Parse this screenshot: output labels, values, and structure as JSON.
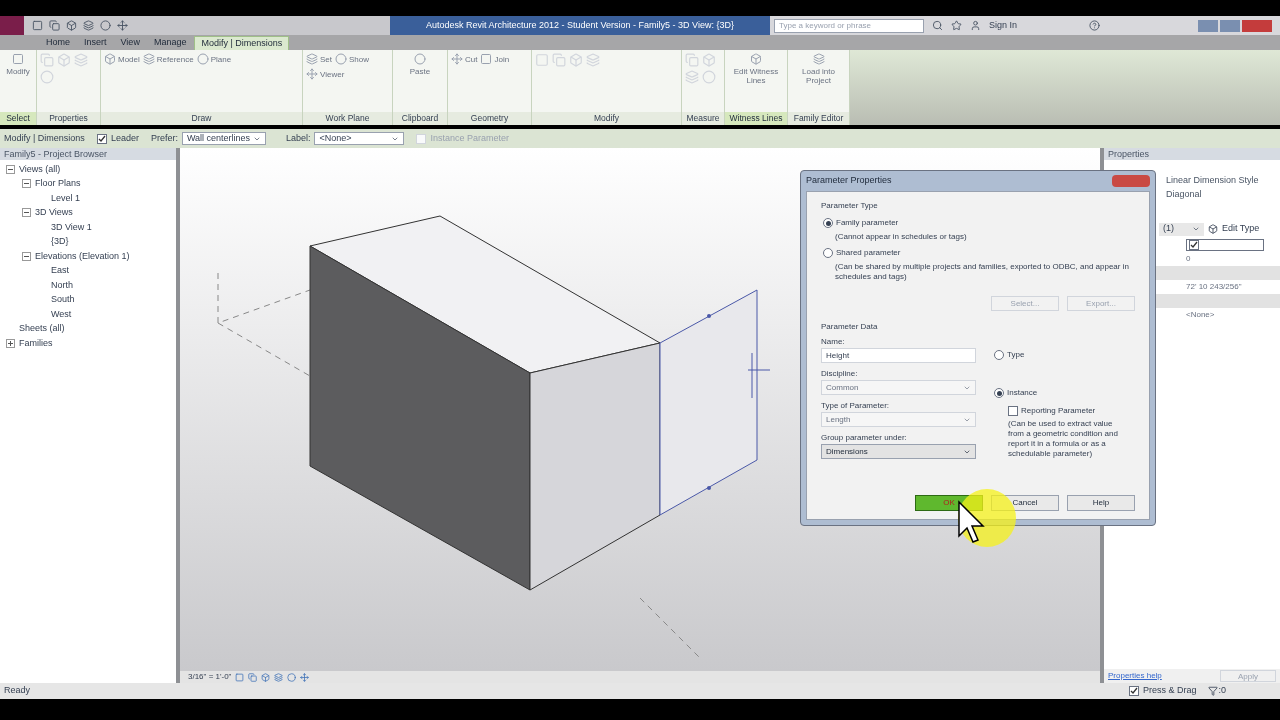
{
  "title_bar": {
    "title": "Autodesk Revit Architecture 2012 - Student Version - Family5 - 3D View: {3D}",
    "search_placeholder": "Type a keyword or phrase",
    "sign_in": "Sign In"
  },
  "tabs": [
    {
      "label": "Home",
      "selected": false
    },
    {
      "label": "Insert",
      "selected": false
    },
    {
      "label": "View",
      "selected": false
    },
    {
      "label": "Manage",
      "selected": false
    },
    {
      "label": "Modify | Dimensions",
      "selected": true
    }
  ],
  "ribbon": [
    {
      "label": "Select",
      "buttons": [
        "Modify"
      ],
      "highlight": true
    },
    {
      "label": "Properties",
      "highlight": false
    },
    {
      "label": "Draw",
      "buttons": [
        "Model",
        "Reference",
        "Plane"
      ],
      "highlight": false
    },
    {
      "label": "Work Plane",
      "buttons": [
        "Set",
        "Show",
        "Viewer"
      ],
      "highlight": false
    },
    {
      "label": "Clipboard",
      "buttons": [
        "Paste"
      ],
      "highlight": false
    },
    {
      "label": "Geometry",
      "buttons": [
        "Cut",
        "Join"
      ],
      "highlight": false
    },
    {
      "label": "Modify",
      "highlight": false
    },
    {
      "label": "Measure",
      "highlight": false
    },
    {
      "label": "Witness Lines",
      "buttons": [
        "Edit Witness Lines"
      ],
      "highlight": true
    },
    {
      "label": "Family Editor",
      "buttons": [
        "Load into Project"
      ],
      "highlight": false
    }
  ],
  "options_bar": {
    "context": "Modify | Dimensions",
    "leader": {
      "label": "Leader",
      "checked": true
    },
    "prefer_label": "Prefer:",
    "prefer_value": "Wall centerlines",
    "label_label": "Label:",
    "label_value": "<None>",
    "instance_parameter": {
      "label": "Instance Parameter",
      "checked": false
    }
  },
  "project_browser": {
    "title": "Family5 - Project Browser",
    "tree": [
      {
        "label": "Views (all)",
        "expanded": true,
        "children": [
          {
            "label": "Floor Plans",
            "expanded": true,
            "children": [
              {
                "label": "Level 1"
              }
            ]
          },
          {
            "label": "3D Views",
            "expanded": true,
            "children": [
              {
                "label": "3D View 1"
              },
              {
                "label": "{3D}"
              }
            ]
          },
          {
            "label": "Elevations (Elevation 1)",
            "expanded": true,
            "children": [
              {
                "label": "East"
              },
              {
                "label": "North"
              },
              {
                "label": "South"
              },
              {
                "label": "West"
              }
            ]
          }
        ]
      },
      {
        "label": "Sheets (all)"
      },
      {
        "label": "Families",
        "expanded": false
      }
    ]
  },
  "view_bar": {
    "scale": "3/16\" = 1'-0\""
  },
  "properties": {
    "title": "Properties",
    "type_name": "Linear Dimension Style",
    "type_sub": "Diagonal",
    "selector": "(1)",
    "edit_type": "Edit Type",
    "rows": [
      {
        "kind": "check",
        "checked": true
      },
      {
        "kind": "text",
        "value": "0"
      },
      {
        "kind": "header"
      },
      {
        "kind": "text",
        "value": "72' 10 243/256\""
      },
      {
        "kind": "header"
      },
      {
        "kind": "text",
        "value": "<None>"
      }
    ],
    "help": "Properties help",
    "apply": "Apply"
  },
  "dialog": {
    "title": "Parameter Properties",
    "type_heading": "Parameter Type",
    "type_options": [
      {
        "label": "Family parameter",
        "note": "(Cannot appear in schedules or tags)",
        "selected": true
      },
      {
        "label": "Shared parameter",
        "note": "(Can be shared by multiple projects and families, exported to ODBC, and appear in schedules and tags)",
        "selected": false
      }
    ],
    "shared_buttons": [
      {
        "label": "Select...",
        "disabled": true
      },
      {
        "label": "Export...",
        "disabled": true
      }
    ],
    "data_heading": "Parameter Data",
    "name_label": "Name:",
    "name_value": "Height",
    "selects": [
      {
        "label": "Discipline:",
        "value": "Common",
        "disabled": true
      },
      {
        "label": "Type of Parameter:",
        "value": "Length",
        "disabled": true
      },
      {
        "label": "Group parameter under:",
        "value": "Dimensions",
        "disabled": false
      }
    ],
    "scope_options": [
      {
        "label": "Type",
        "selected": false
      },
      {
        "label": "Instance",
        "selected": true
      }
    ],
    "reporting": {
      "label": "Reporting Parameter",
      "checked": false,
      "note": "(Can be used to extract value from a geometric condition and report it in a formula or as a schedulable parameter)"
    },
    "buttons": [
      {
        "label": "OK",
        "default": true
      },
      {
        "label": "Cancel",
        "default": false
      },
      {
        "label": "Help",
        "default": false
      }
    ]
  },
  "status_bar": {
    "text": "Ready",
    "press_drag": {
      "label": "Press & Drag",
      "checked": true
    },
    "filter_count": ":0"
  }
}
